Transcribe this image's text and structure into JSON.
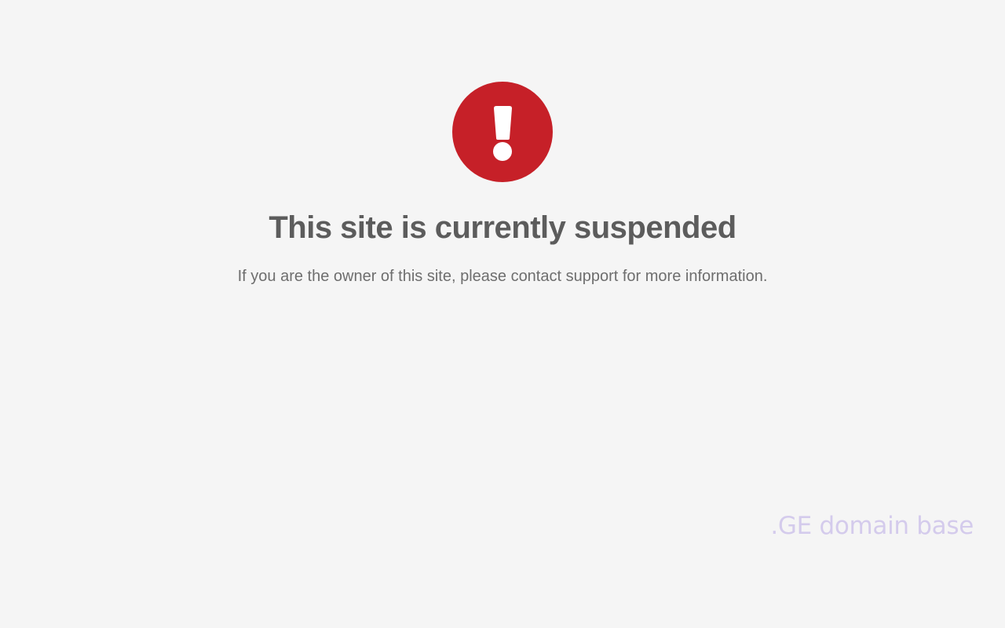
{
  "alert": {
    "icon": "exclamation-circle-icon",
    "color": "#c62028"
  },
  "headline": "This site is currently suspended",
  "message": "If you are the owner of this site, please contact support for more information.",
  "watermark": ".GE domain base",
  "colors": {
    "background": "#f5f5f5",
    "headline": "#5c5c5c",
    "message": "#6e6e6e",
    "watermark": "#d4cbec"
  }
}
